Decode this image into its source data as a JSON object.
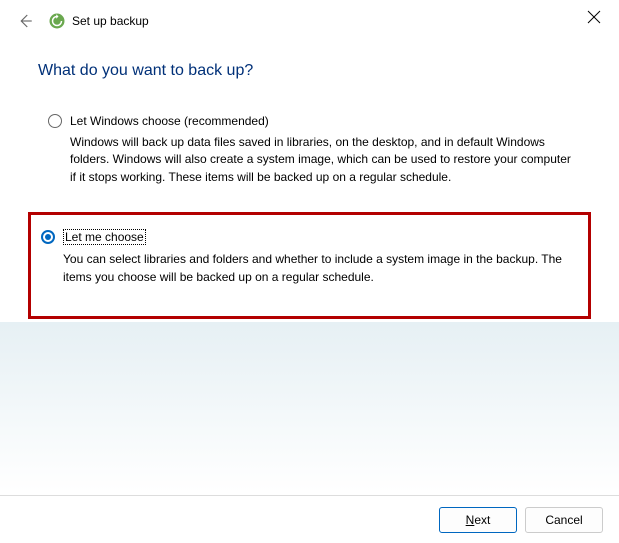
{
  "window": {
    "title": "Set up backup"
  },
  "page": {
    "heading": "What do you want to back up?"
  },
  "options": {
    "windows_choose": {
      "label": "Let Windows choose (recommended)",
      "description": "Windows will back up data files saved in libraries, on the desktop, and in default Windows folders. Windows will also create a system image, which can be used to restore your computer if it stops working. These items will be backed up on a regular schedule.",
      "selected": false
    },
    "let_me_choose": {
      "label": "Let me choose",
      "description": "You can select libraries and folders and whether to include a system image in the backup. The items you choose will be backed up on a regular schedule.",
      "selected": true
    }
  },
  "buttons": {
    "next_prefix": "N",
    "next_suffix": "ext",
    "cancel": "Cancel"
  }
}
